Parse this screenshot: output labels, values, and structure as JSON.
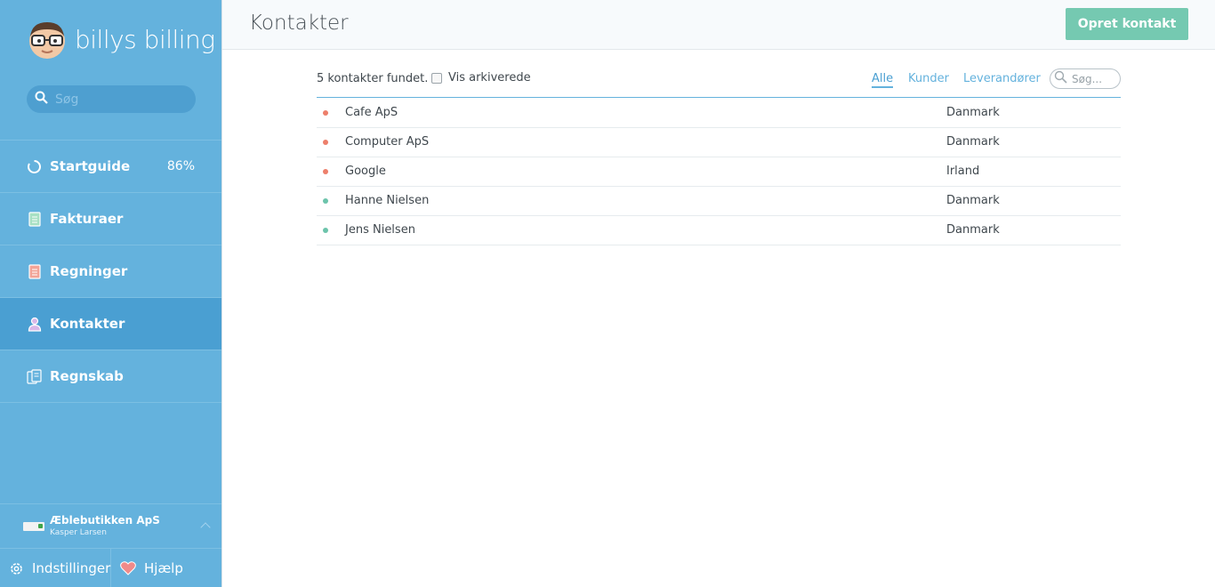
{
  "app": {
    "logo_text": "billys billing"
  },
  "sidebar": {
    "search_placeholder": "Søg",
    "items": [
      {
        "label": "Startguide",
        "badge": "86%",
        "icon": "progress-circle-icon"
      },
      {
        "label": "Fakturaer",
        "icon": "invoice-document-icon"
      },
      {
        "label": "Regninger",
        "icon": "bill-document-icon"
      },
      {
        "label": "Kontakter",
        "icon": "person-icon",
        "active": true
      },
      {
        "label": "Regnskab",
        "icon": "ledger-documents-icon"
      }
    ],
    "company": {
      "name": "Æblebutikken ApS",
      "user": "Kasper Larsen"
    },
    "bottom": {
      "settings_label": "Indstillinger",
      "help_label": "Hjælp"
    }
  },
  "header": {
    "title": "Kontakter",
    "create_button": "Opret kontakt"
  },
  "toolbar": {
    "count_text": "5 kontakter fundet.",
    "archive_label": "Vis arkiverede",
    "filters": [
      "Alle",
      "Kunder",
      "Leverandører"
    ],
    "active_filter": "Alle",
    "search_placeholder": "Søg..."
  },
  "contacts": [
    {
      "name": "Cafe ApS",
      "country": "Danmark",
      "status_color": "#ed7f6b"
    },
    {
      "name": "Computer ApS",
      "country": "Danmark",
      "status_color": "#ed7f6b"
    },
    {
      "name": "Google",
      "country": "Irland",
      "status_color": "#ed7f6b"
    },
    {
      "name": "Hanne Nielsen",
      "country": "Danmark",
      "status_color": "#6cc4ab"
    },
    {
      "name": "Jens Nielsen",
      "country": "Danmark",
      "status_color": "#6cc4ab"
    }
  ],
  "colors": {
    "sidebar": "#64b2dd",
    "accent": "#75c9b1",
    "supplier": "#ed7f6b",
    "customer": "#6cc4ab"
  }
}
